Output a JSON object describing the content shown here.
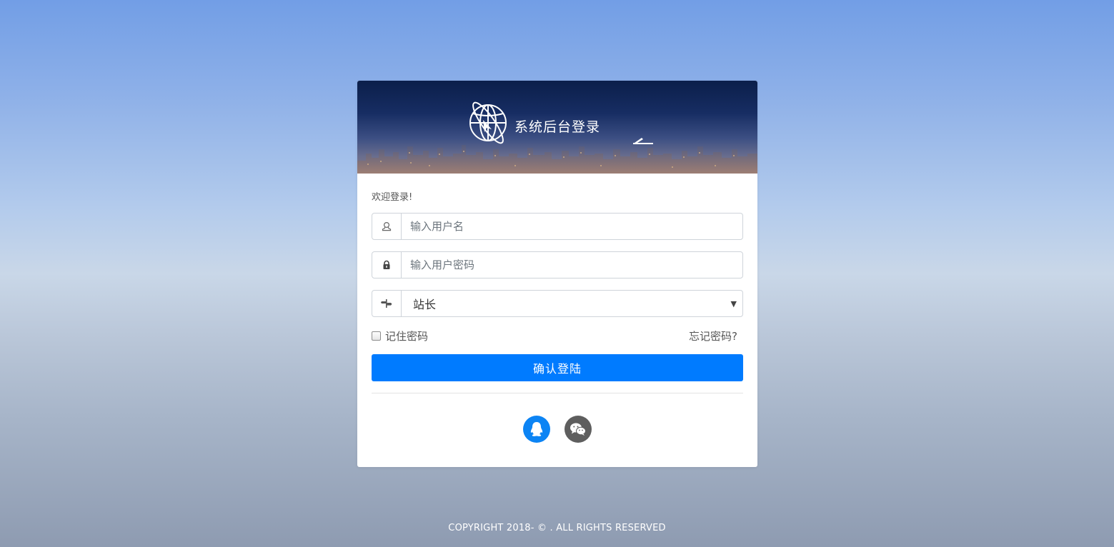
{
  "header": {
    "title": "系统后台登录"
  },
  "form": {
    "welcome": "欢迎登录!",
    "username_placeholder": "输入用户名",
    "password_placeholder": "输入用户密码",
    "role_selected": "站长",
    "remember_label": "记住密码",
    "forgot_label": "忘记密码?",
    "submit_label": "确认登陆"
  },
  "icons": {
    "username": "user-icon",
    "password": "lock-icon",
    "role": "role-icon",
    "qq": "qq-icon",
    "wechat": "wechat-icon"
  },
  "colors": {
    "primary": "#007bff",
    "qq": "#0c84f4",
    "wechat": "#5e5e5e"
  },
  "footer": {
    "copyright": "COPYRIGHT 2018- © . ALL RIGHTS RESERVED"
  }
}
